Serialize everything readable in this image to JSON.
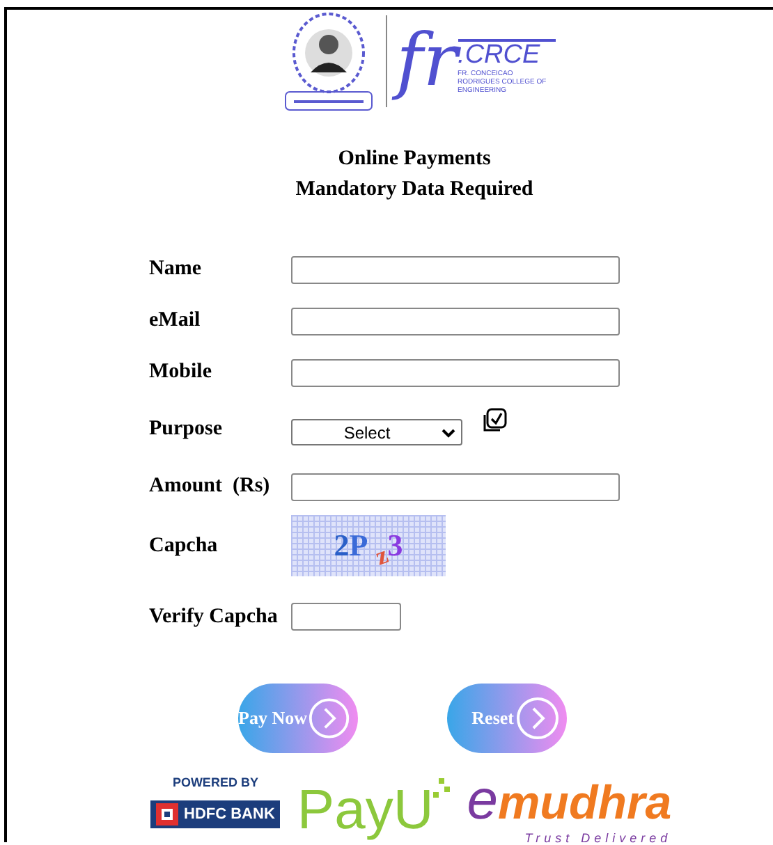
{
  "header_logo": {
    "monogram": "fr",
    "name": ".CRCE",
    "college": "FR. CONCEICAO RODRIGUES COLLEGE OF ENGINEERING"
  },
  "heading": [
    "Online Payments",
    "Mandatory Data Required"
  ],
  "fields": [
    {
      "kind": "text",
      "label": "Name"
    },
    {
      "kind": "text",
      "label": "eMail"
    },
    {
      "kind": "text",
      "label": "Mobile"
    },
    {
      "kind": "select",
      "label": "Purpose",
      "value": "Select",
      "checked": true
    },
    {
      "kind": "text",
      "label": "Amount  (Rs)"
    },
    {
      "kind": "captcha",
      "label": "Capcha",
      "captcha": [
        "2",
        "P",
        "z",
        "3"
      ]
    },
    {
      "kind": "short",
      "label": "Verify Capcha"
    }
  ],
  "buttons": [
    "Pay Now",
    "Reset"
  ],
  "footer": {
    "powered_by": "POWERED BY",
    "bank": "HDFC BANK",
    "gateway": "PayU",
    "sign_e": "e",
    "sign_name": "mudhra",
    "sign_tagline": "Trust Delivered"
  }
}
